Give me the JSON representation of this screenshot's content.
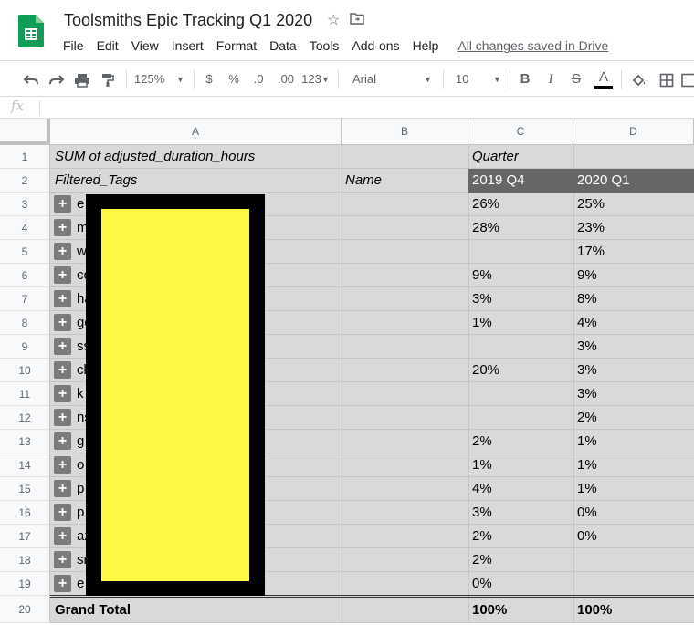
{
  "app": {
    "title": "Toolsmiths Epic Tracking Q1 2020",
    "menus": [
      "File",
      "Edit",
      "View",
      "Insert",
      "Format",
      "Data",
      "Tools",
      "Add-ons",
      "Help"
    ],
    "save_status": "All changes saved in Drive"
  },
  "toolbar": {
    "zoom": "125%",
    "currency": "$",
    "percent": "%",
    "decrease_decimal": ".0",
    "increase_decimal": ".00",
    "more_formats": "123",
    "font": "Arial",
    "font_size": "10",
    "bold": "B",
    "italic": "I",
    "strike": "S",
    "text_color": "A"
  },
  "formula_bar": {
    "fx": "fx",
    "value": ""
  },
  "columns": [
    "A",
    "B",
    "C",
    "D"
  ],
  "rows": [
    "1",
    "2",
    "3",
    "4",
    "5",
    "6",
    "7",
    "8",
    "9",
    "10",
    "11",
    "12",
    "13",
    "14",
    "15",
    "16",
    "17",
    "18",
    "19",
    "20"
  ],
  "pivot": {
    "value_label": "SUM of adjusted_duration_hours",
    "quarter_label": "Quarter",
    "row_field": "Filtered_Tags",
    "name_field": "Name",
    "quarters": [
      "2019 Q4",
      "2020 Q1"
    ],
    "tag_stubs": [
      "e",
      "m",
      "w",
      "co",
      "ha",
      "ge",
      "ss",
      "cl",
      "k",
      "ns",
      "g",
      "o",
      "p",
      "p",
      "az",
      "sr",
      "e"
    ],
    "data": [
      [
        "26%",
        "25%"
      ],
      [
        "28%",
        "23%"
      ],
      [
        "",
        "17%"
      ],
      [
        "9%",
        "9%"
      ],
      [
        "3%",
        "8%"
      ],
      [
        "1%",
        "4%"
      ],
      [
        "",
        "3%"
      ],
      [
        "20%",
        "3%"
      ],
      [
        "",
        "3%"
      ],
      [
        "",
        "2%"
      ],
      [
        "2%",
        "1%"
      ],
      [
        "1%",
        "1%"
      ],
      [
        "4%",
        "1%"
      ],
      [
        "3%",
        "0%"
      ],
      [
        "2%",
        "0%"
      ],
      [
        "2%",
        ""
      ],
      [
        "0%",
        ""
      ]
    ],
    "grand_total_label": "Grand Total",
    "grand_total": [
      "100%",
      "100%"
    ]
  }
}
